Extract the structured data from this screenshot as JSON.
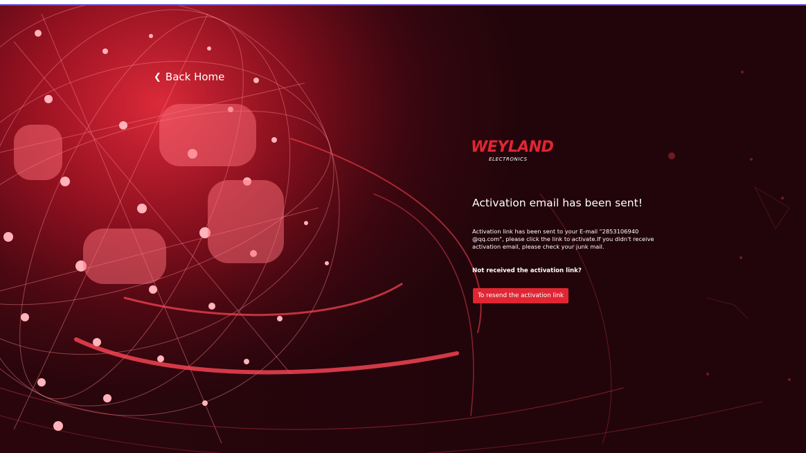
{
  "nav": {
    "back_label": "Back Home"
  },
  "brand": {
    "name": "WEYLAND",
    "tagline": "ELECTRONICS",
    "color": "#e02633"
  },
  "activation": {
    "title": "Activation email has been sent!",
    "message": "Activation link has been sent to your E-mail \"2853106940 @qq.com\", please click the link to activate.If you didn't receive activation email, please check your junk mail.",
    "not_received": "Not received the activation link?",
    "resend_label": "To resend the activation link"
  },
  "icons": {
    "back": "chevron-left-icon"
  }
}
